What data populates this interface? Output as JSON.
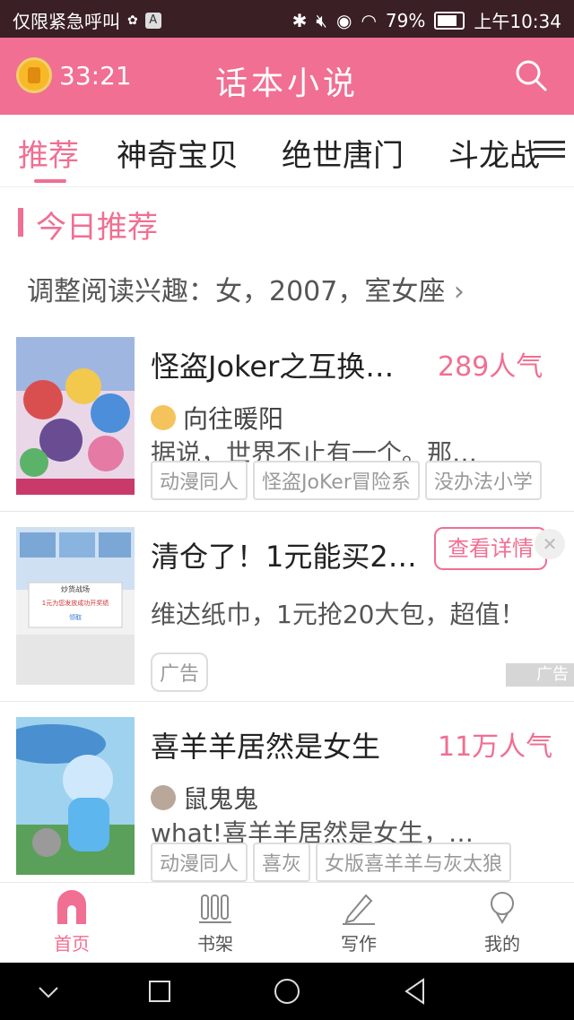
{
  "status_bar": {
    "carrier": "仅限紧急呼叫",
    "battery": "79%",
    "time": "上午10:34"
  },
  "header": {
    "timer": "33:21",
    "title": "话本小说"
  },
  "tabs": [
    {
      "label": "推荐",
      "active": true
    },
    {
      "label": "神奇宝贝",
      "active": false
    },
    {
      "label": "绝世唐门",
      "active": false
    },
    {
      "label": "斗龙战",
      "active": false
    }
  ],
  "section": {
    "title": "今日推荐",
    "interest": "调整阅读兴趣：女，2007，室女座"
  },
  "cards": [
    {
      "title": "怪盗Joker之互换…",
      "popularity": "289人气",
      "author": "向往暖阳",
      "desc": "据说，世界不止有一个。那…",
      "tags": [
        "动漫同人",
        "怪盗JoKer冒险系",
        "没办法小学"
      ]
    },
    {
      "title": "清仓了！1元能买2…",
      "cta": "查看详情",
      "desc": "维达纸巾，1元抢20大包，超值！",
      "tag": "广告",
      "ad_badge": "广告",
      "cover_text": [
        "炒货战场",
        "1元为您发放成功开奖绩",
        "领取"
      ]
    },
    {
      "title": "喜羊羊居然是女生",
      "popularity": "11万人气",
      "author": "鼠鬼鬼",
      "desc": "what!喜羊羊居然是女生，…",
      "tags": [
        "动漫同人",
        "喜灰",
        "女版喜羊羊与灰太狼"
      ]
    }
  ],
  "bottom_nav": [
    {
      "label": "首页",
      "icon": "home-icon",
      "active": true
    },
    {
      "label": "书架",
      "icon": "bookshelf-icon",
      "active": false
    },
    {
      "label": "写作",
      "icon": "pencil-icon",
      "active": false
    },
    {
      "label": "我的",
      "icon": "profile-icon",
      "active": false
    }
  ],
  "colors": {
    "accent": "#f06f92",
    "status_bar": "#3a1f25"
  }
}
